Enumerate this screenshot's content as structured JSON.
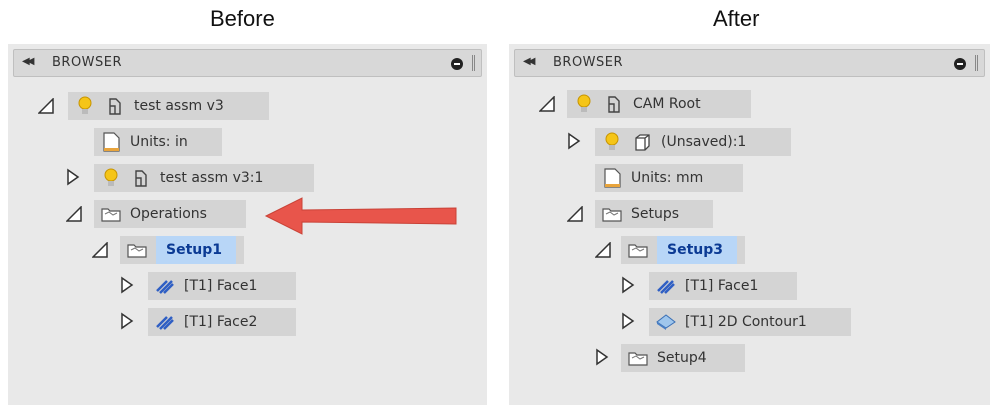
{
  "captions": {
    "before": "Before",
    "after": "After"
  },
  "panels": {
    "before": {
      "title": "BROWSER",
      "nodes": [
        {
          "label": "test assm v3"
        },
        {
          "label": "Units: in"
        },
        {
          "label": "test assm v3:1"
        },
        {
          "label": "Operations"
        },
        {
          "label": "Setup1"
        },
        {
          "label": "[T1] Face1"
        },
        {
          "label": "[T1] Face2"
        }
      ]
    },
    "after": {
      "title": "BROWSER",
      "nodes": [
        {
          "label": "CAM Root"
        },
        {
          "label": "(Unsaved):1"
        },
        {
          "label": "Units: mm"
        },
        {
          "label": "Setups"
        },
        {
          "label": "Setup3"
        },
        {
          "label": "[T1] Face1"
        },
        {
          "label": "[T1] 2D Contour1"
        },
        {
          "label": "Setup4"
        }
      ]
    }
  },
  "colors": {
    "selection": "#b8d6f7",
    "selected_text": "#0b3a94",
    "callout_arrow": "#e8554b"
  },
  "icons": [
    "collapse-double-arrow-icon",
    "minus-circle-icon",
    "lightbulb-icon",
    "component-icon",
    "document-icon",
    "folder-icon",
    "toolpath-icon",
    "contour-icon",
    "box-icon",
    "expand-triangle-icon",
    "collapse-triangle-icon"
  ]
}
